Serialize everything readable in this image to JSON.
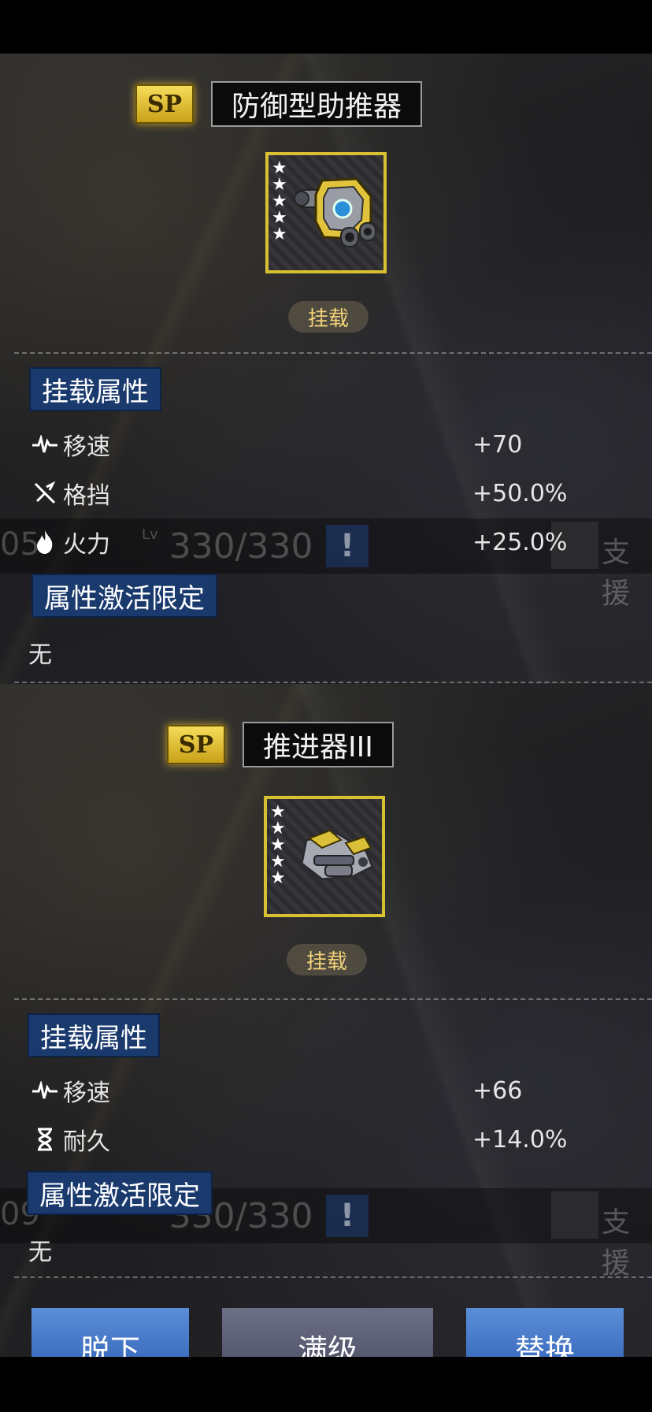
{
  "items": [
    {
      "badge": "SP",
      "name": "防御型助推器",
      "stars": 5,
      "tag": "挂载",
      "attr_label": "挂载属性",
      "stats": [
        {
          "icon": "speed-icon",
          "name": "移速",
          "value": "+70"
        },
        {
          "icon": "block-icon",
          "name": "格挡",
          "value": "+50.0%"
        },
        {
          "icon": "fire-icon",
          "name": "火力",
          "value": "+25.0%"
        }
      ],
      "limit_label": "属性激活限定",
      "limit_value": "无",
      "bg_row": {
        "num": "05",
        "lv": "330/330",
        "support": "支援"
      }
    },
    {
      "badge": "SP",
      "name": "推进器III",
      "stars": 5,
      "tag": "挂载",
      "attr_label": "挂载属性",
      "stats": [
        {
          "icon": "speed-icon",
          "name": "移速",
          "value": "+66"
        },
        {
          "icon": "hourglass-icon",
          "name": "耐久",
          "value": "+14.0%"
        }
      ],
      "limit_label": "属性激活限定",
      "limit_value": "无",
      "bg_row": {
        "num": "09",
        "lv": "330/330",
        "support": "支援"
      }
    }
  ],
  "buttons": {
    "unequip": "脱下",
    "max_level": "满级",
    "replace": "替换"
  },
  "colors": {
    "badge_gold": "#e9c53a",
    "label_blue": "#1a3a6e",
    "frame_gold": "#d8c033"
  }
}
